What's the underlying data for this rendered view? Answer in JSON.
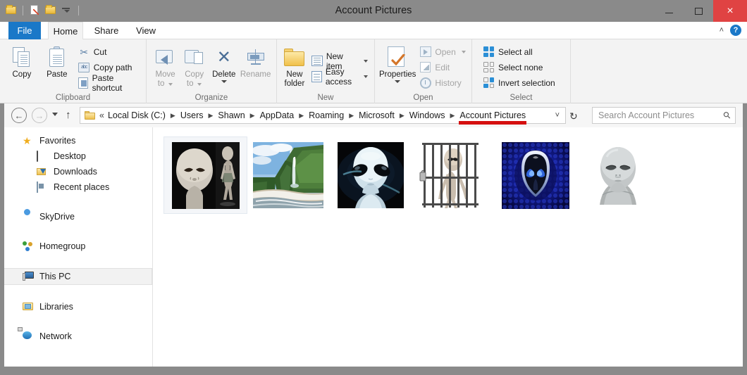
{
  "window": {
    "title": "Account Pictures",
    "quick_access": [
      "folder-icon",
      "save-icon",
      "folder-properties-icon",
      "customize-caret-icon"
    ],
    "controls": {
      "minimize": "minimize-icon",
      "maximize": "maximize-icon",
      "close": "×"
    },
    "close_color": "#e04343"
  },
  "tabs": [
    {
      "label": "File",
      "id": "file",
      "active": false,
      "accent": "#1a78c8"
    },
    {
      "label": "Home",
      "id": "home",
      "active": true
    },
    {
      "label": "Share",
      "id": "share",
      "active": false
    },
    {
      "label": "View",
      "id": "view",
      "active": false
    }
  ],
  "ribbon_right": {
    "collapse": "˄",
    "help": "?"
  },
  "ribbon": {
    "groups": [
      {
        "label": "Clipboard",
        "big": [
          {
            "label": "Copy",
            "icon": "copy-icon",
            "disabled": false
          },
          {
            "label": "Paste",
            "icon": "paste-icon",
            "disabled": false
          }
        ],
        "small": [
          {
            "label": "Cut",
            "icon": "scissors-icon",
            "disabled": false
          },
          {
            "label": "Copy path",
            "icon": "copy-path-icon",
            "disabled": false
          },
          {
            "label": "Paste shortcut",
            "icon": "paste-shortcut-icon",
            "disabled": false
          }
        ]
      },
      {
        "label": "Organize",
        "big": [
          {
            "label": "Move\nto",
            "label_line1": "Move",
            "label_line2": "to",
            "icon": "move-to-icon",
            "disabled": true,
            "dropdown": true
          },
          {
            "label": "Copy\nto",
            "label_line1": "Copy",
            "label_line2": "to",
            "icon": "copy-to-icon",
            "disabled": true,
            "dropdown": true
          },
          {
            "label": "Delete",
            "icon": "delete-icon",
            "disabled": false,
            "split": true
          },
          {
            "label": "Rename",
            "icon": "rename-icon",
            "disabled": true
          }
        ]
      },
      {
        "label": "New",
        "big": [
          {
            "label_line1": "New",
            "label_line2": "folder",
            "icon": "new-folder-icon",
            "disabled": false
          }
        ],
        "small": [
          {
            "label": "New item",
            "icon": "new-item-icon",
            "disabled": false,
            "dropdown": true
          },
          {
            "label": "Easy access",
            "icon": "easy-access-icon",
            "disabled": false,
            "dropdown": true
          }
        ]
      },
      {
        "label": "Open",
        "big": [
          {
            "label": "Properties",
            "icon": "properties-icon",
            "disabled": false,
            "split": true
          }
        ],
        "small": [
          {
            "label": "Open",
            "icon": "open-icon",
            "disabled": true,
            "dropdown": true
          },
          {
            "label": "Edit",
            "icon": "edit-icon",
            "disabled": true
          },
          {
            "label": "History",
            "icon": "history-icon",
            "disabled": true
          }
        ]
      },
      {
        "label": "Select",
        "small": [
          {
            "label": "Select all",
            "icon": "select-all-icon",
            "disabled": false
          },
          {
            "label": "Select none",
            "icon": "select-none-icon",
            "disabled": false
          },
          {
            "label": "Invert selection",
            "icon": "invert-selection-icon",
            "disabled": false
          }
        ]
      }
    ]
  },
  "address": {
    "back": "←",
    "forward": "→",
    "up": "↑",
    "double_chevron": "«",
    "crumbs": [
      "Local Disk (C:)",
      "Users",
      "Shawn",
      "AppData",
      "Roaming",
      "Microsoft",
      "Windows",
      "Account Pictures"
    ],
    "current_crumb": "Account Pictures",
    "highlight_color": "#d50f0f",
    "dropdown": "˅",
    "refresh": "↻"
  },
  "search": {
    "placeholder": "Search Account Pictures",
    "icon": "search-icon"
  },
  "sidebar": {
    "items": [
      {
        "label": "Favorites",
        "icon": "star-icon",
        "indent": false,
        "selected": false
      },
      {
        "label": "Desktop",
        "icon": "desktop-icon",
        "indent": true,
        "selected": false
      },
      {
        "label": "Downloads",
        "icon": "downloads-icon",
        "indent": true,
        "selected": false
      },
      {
        "label": "Recent places",
        "icon": "recent-places-icon",
        "indent": true,
        "selected": false
      },
      {
        "label": "SkyDrive",
        "icon": "cloud-icon",
        "indent": false,
        "selected": false,
        "gap_before": true
      },
      {
        "label": "Homegroup",
        "icon": "homegroup-icon",
        "indent": false,
        "selected": false,
        "gap_before": true
      },
      {
        "label": "This PC",
        "icon": "this-pc-icon",
        "indent": false,
        "selected": true,
        "gap_before": true
      },
      {
        "label": "Libraries",
        "icon": "libraries-icon",
        "indent": false,
        "selected": false,
        "gap_before": true
      },
      {
        "label": "Network",
        "icon": "network-icon",
        "indent": false,
        "selected": false,
        "gap_before": true
      }
    ]
  },
  "content": {
    "view_mode": "large-icons",
    "items": [
      {
        "name": "alien-head-and-figure-thumbnail",
        "selected": true
      },
      {
        "name": "waterfall-beach-landscape-thumbnail",
        "selected": false
      },
      {
        "name": "blue-white-alien-thumbnail",
        "selected": false
      },
      {
        "name": "caged-alien-thumbnail",
        "selected": false
      },
      {
        "name": "alienware-logo-blue-thumbnail",
        "selected": false
      },
      {
        "name": "grey-alien-bust-thumbnail",
        "selected": false
      }
    ]
  }
}
